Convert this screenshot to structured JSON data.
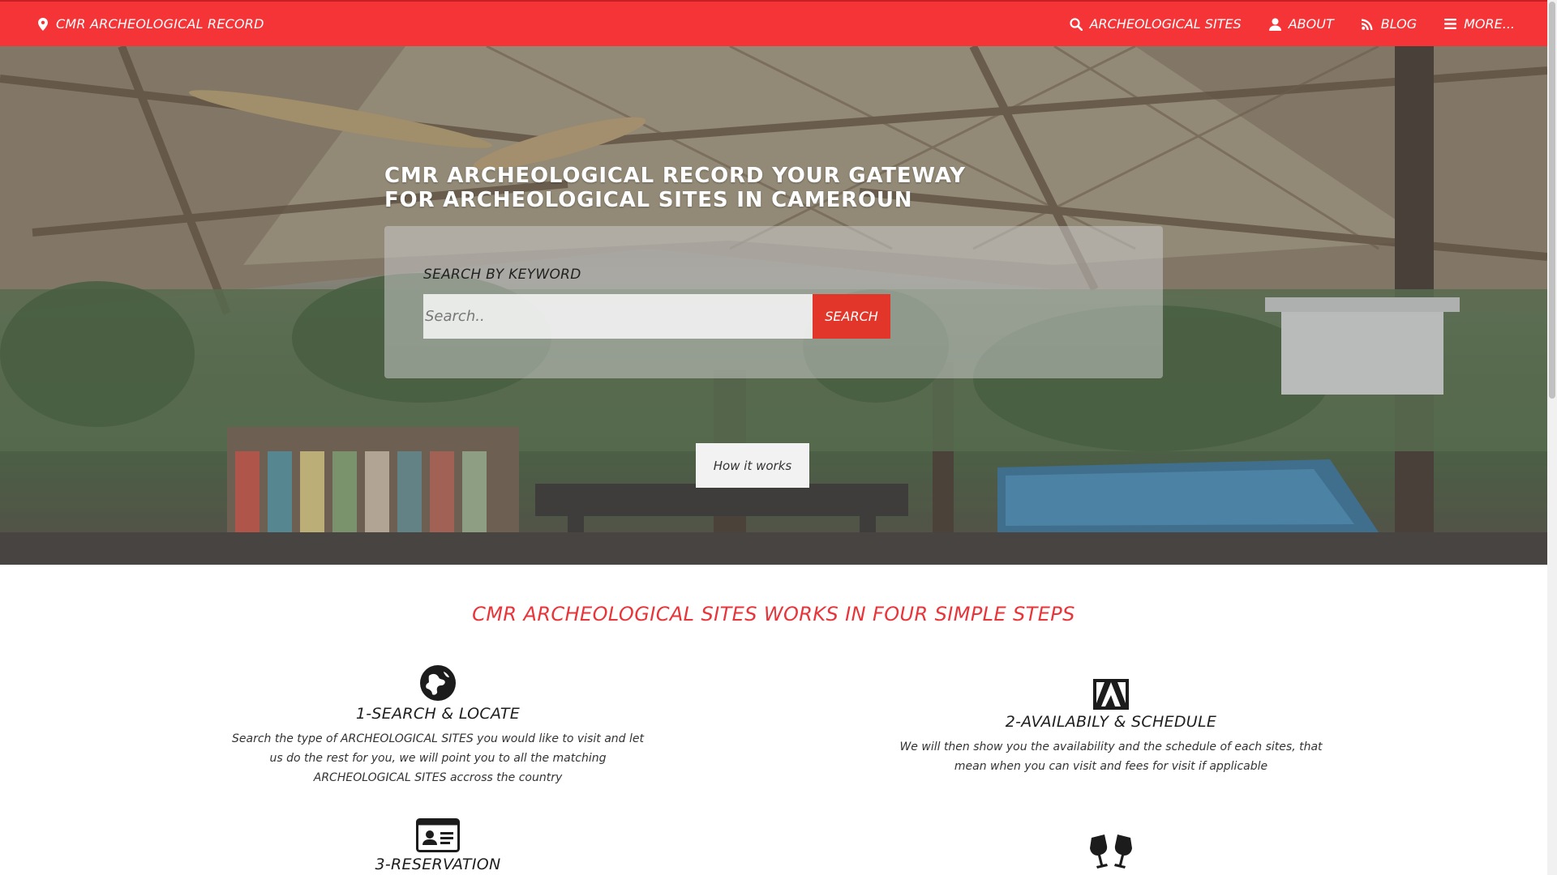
{
  "navbar": {
    "brand": "CMR ARCHEOLOGICAL RECORD",
    "links": [
      {
        "label": "ARCHEOLOGICAL SITES",
        "icon": "search-icon"
      },
      {
        "label": "ABOUT",
        "icon": "user-icon"
      },
      {
        "label": "BLOG",
        "icon": "rss-icon"
      },
      {
        "label": "MORE...",
        "icon": "menu-icon"
      }
    ]
  },
  "hero": {
    "title": "CMR ARCHEOLOGICAL RECORD YOUR GATEWAY FOR ARCHEOLOGICAL SITES IN CAMEROUN",
    "search_label": "SEARCH BY KEYWORD",
    "search_placeholder": "Search..",
    "search_button": "SEARCH",
    "how_button": "How it works"
  },
  "steps": {
    "title": "CMR ARCHEOLOGICAL SITES WORKS IN FOUR SIMPLE STEPS",
    "items": [
      {
        "name": "1-SEARCH & LOCATE",
        "icon": "globe-icon",
        "desc": "Search the type of ARCHEOLOGICAL SITES you would like to visit and let us do the rest for you, we will point you to all the matching ARCHEOLOGICAL SITES accross the country"
      },
      {
        "name": "2-AVAILABILY & SCHEDULE",
        "icon": "adobe-icon",
        "desc": "We will then show you the availability and the schedule of each sites, that mean when you can visit and fees for visit if applicable"
      },
      {
        "name": "3-RESERVATION",
        "icon": "id-card-icon",
        "desc": ""
      },
      {
        "name": "",
        "icon": "glasses-cheers-icon",
        "desc": ""
      }
    ]
  },
  "colors": {
    "navbar": "#f43437",
    "accent": "#e8353a",
    "search_button": "#e2362a"
  }
}
